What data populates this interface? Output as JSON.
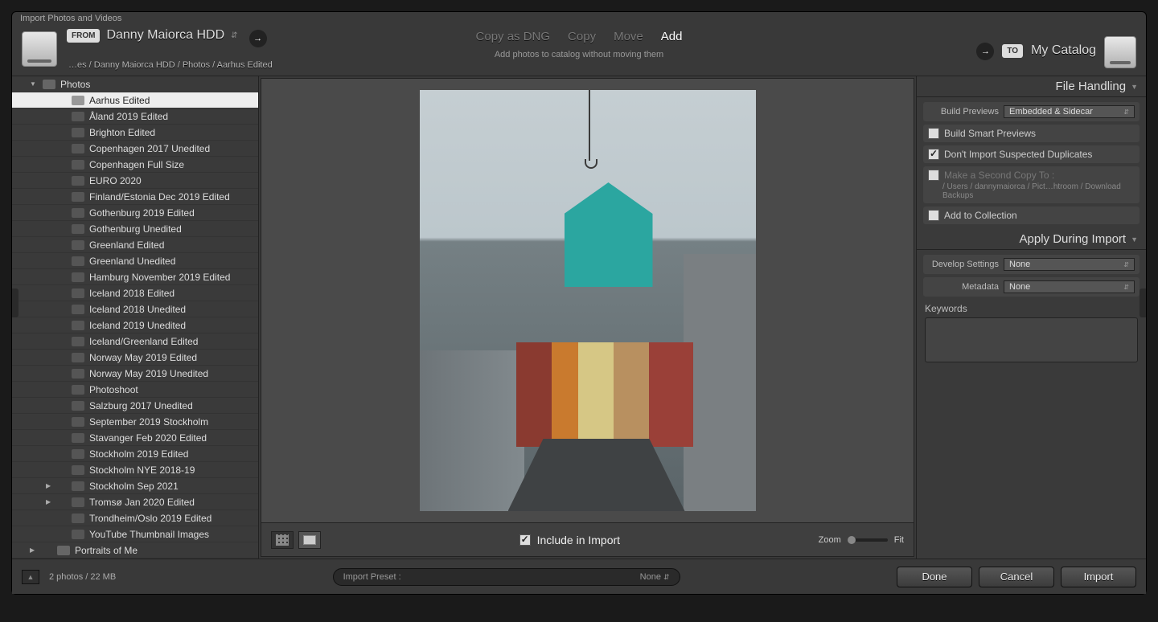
{
  "window_title": "Import Photos and Videos",
  "source": {
    "badge": "FROM",
    "label": "Danny Maiorca HDD",
    "path": "…es / Danny Maiorca HDD / Photos / Aarhus Edited"
  },
  "modes": {
    "copy_dng": "Copy as DNG",
    "copy": "Copy",
    "move": "Move",
    "add": "Add",
    "desc": "Add photos to catalog without moving them"
  },
  "dest": {
    "badge": "TO",
    "label": "My Catalog"
  },
  "folders": {
    "parent": "Photos",
    "items": [
      "Aarhus Edited",
      "Åland 2019 Edited",
      "Brighton Edited",
      "Copenhagen 2017 Unedited",
      "Copenhagen Full Size",
      "EURO 2020",
      "Finland/Estonia Dec 2019 Edited",
      "Gothenburg 2019 Edited",
      "Gothenburg Unedited",
      "Greenland Edited",
      "Greenland Unedited",
      "Hamburg November 2019 Edited",
      "Iceland 2018 Edited",
      "Iceland 2018 Unedited",
      "Iceland 2019 Unedited",
      "Iceland/Greenland Edited",
      "Norway May 2019 Edited",
      "Norway May 2019 Unedited",
      "Photoshoot",
      "Salzburg 2017 Unedited",
      "September 2019 Stockholm",
      "Stavanger Feb 2020 Edited",
      "Stockholm 2019 Edited",
      "Stockholm NYE 2018-19",
      "Stockholm Sep 2021",
      "Tromsø Jan 2020 Edited",
      "Trondheim/Oslo 2019 Edited",
      "YouTube Thumbnail Images"
    ],
    "sibling": "Portraits of Me",
    "selected_index": 0,
    "expandable_indices": [
      24,
      25
    ]
  },
  "center": {
    "include_label": "Include in Import",
    "zoom_label": "Zoom",
    "fit_label": "Fit"
  },
  "right": {
    "file_handling": {
      "title": "File Handling",
      "build_previews_label": "Build Previews",
      "build_previews_value": "Embedded & Sidecar",
      "smart_previews": "Build Smart Previews",
      "dont_import_dupes": "Don't Import Suspected Duplicates",
      "second_copy": "Make a Second Copy To :",
      "second_copy_path": "/ Users / dannymaiorca / Pict…htroom / Download Backups",
      "add_collection": "Add to Collection"
    },
    "apply": {
      "title": "Apply During Import",
      "develop_label": "Develop Settings",
      "develop_value": "None",
      "metadata_label": "Metadata",
      "metadata_value": "None",
      "keywords_label": "Keywords"
    }
  },
  "footer": {
    "status": "2 photos / 22 MB",
    "preset_label": "Import Preset :",
    "preset_value": "None",
    "done": "Done",
    "cancel": "Cancel",
    "import": "Import"
  }
}
